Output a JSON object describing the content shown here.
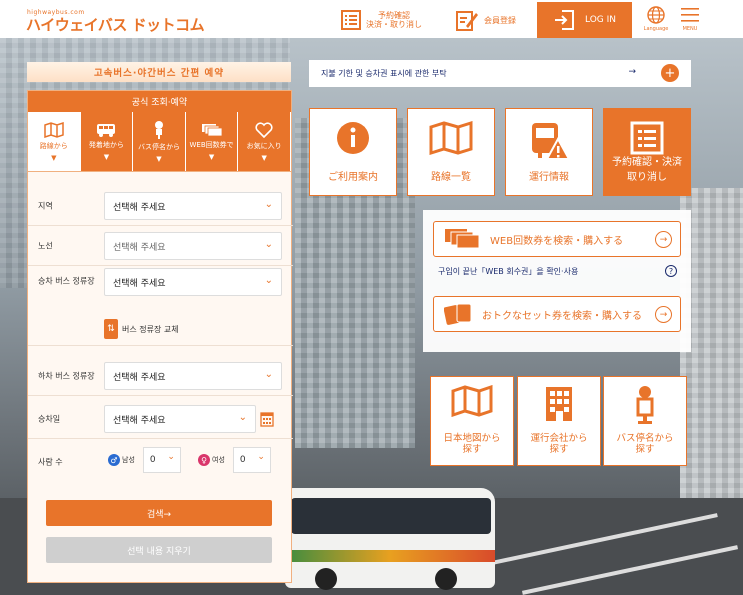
{
  "header": {
    "logo_small": "highwaybus.com",
    "logo_main": "ハイウェイバス ドットコム",
    "reserve_check_line1": "予約確認",
    "reserve_check_line2": "決済・取り消し",
    "member_register": "会員登録",
    "login": "LOG IN",
    "language": "Language",
    "menu": "MENU"
  },
  "panel": {
    "title": "고속버스·야간버스 간편 예약",
    "header": "공식 조회·예약",
    "tabs": [
      {
        "label": "路線から",
        "icon": "map-icon"
      },
      {
        "label": "発着地から",
        "icon": "bus-icon"
      },
      {
        "label": "バス停名から",
        "icon": "bus-stop-icon"
      },
      {
        "label": "WEB回数券で",
        "icon": "tickets-icon"
      },
      {
        "label": "お気に入り",
        "icon": "heart-icon"
      }
    ],
    "fields": {
      "region_label": "지역",
      "route_label": "노선",
      "boarding_label": "승차 버스 정류장",
      "alighting_label": "하차 버스 정류장",
      "date_label": "승차일",
      "people_label": "사람 수",
      "placeholder": "선택해 주세요",
      "swap_label": "버스 정류장 교체",
      "male_label": "남성",
      "female_label": "여성",
      "male_count": "0",
      "female_count": "0"
    },
    "search_button": "검색→",
    "clear_button": "선택 내용 지우기"
  },
  "notice": {
    "text": "지불 기한 및 승차권 표시에 관한 부탁",
    "arrow": "→"
  },
  "cards": [
    {
      "label": "ご利用案内",
      "icon": "info-icon"
    },
    {
      "label": "路線一覧",
      "icon": "map-icon"
    },
    {
      "label": "運行情報",
      "icon": "bus-alert-icon"
    },
    {
      "label_line1": "予約確認・決済",
      "label_line2": "取り消し",
      "icon": "list-icon"
    }
  ],
  "web": {
    "coupon_button": "WEB回数券を検索・購入する",
    "coupon_link": "구입이 끝난「WEB 회수권」을 확인·사용",
    "set_button": "おトクなセット券を検索・購入する"
  },
  "search_boxes": [
    {
      "line1": "日本地図から",
      "line2": "探す",
      "icon": "japan-map-icon"
    },
    {
      "line1": "運行会社から",
      "line2": "探す",
      "icon": "building-icon"
    },
    {
      "line1": "バス停名から",
      "line2": "探す",
      "icon": "bus-stop-icon"
    }
  ],
  "colors": {
    "accent": "#e8742a",
    "navy": "#1a2a6c"
  }
}
